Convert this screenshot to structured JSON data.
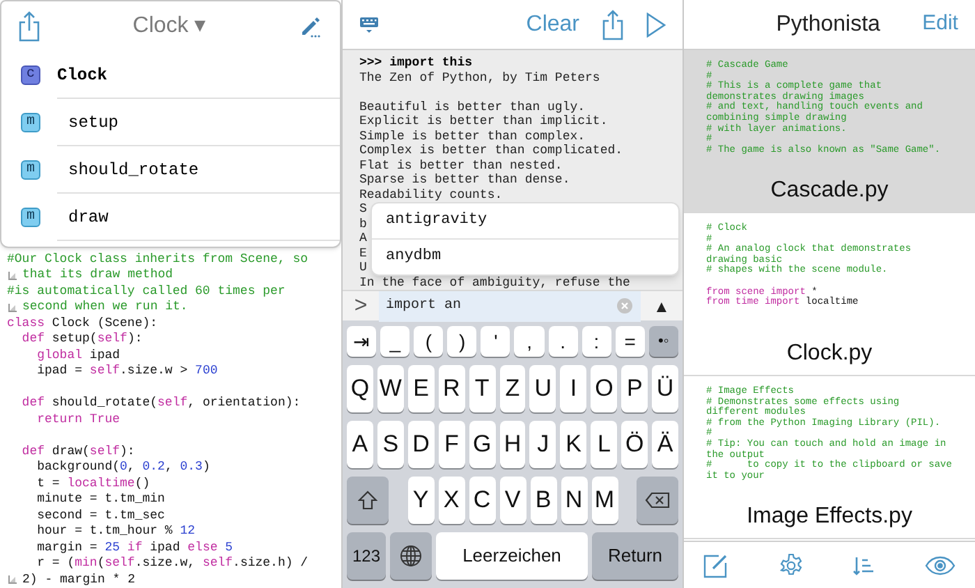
{
  "editor": {
    "title": "Clock ▾",
    "outline": [
      {
        "kind": "class",
        "badge": "c",
        "label": "Clock"
      },
      {
        "kind": "method",
        "badge": "m",
        "label": "setup"
      },
      {
        "kind": "method",
        "badge": "m",
        "label": "should_rotate"
      },
      {
        "kind": "method",
        "badge": "m",
        "label": "draw"
      }
    ],
    "code_lines": [
      {
        "kind": "code",
        "tokens": [
          {
            "kind": "comment",
            "text": "#Our Clock class inherits from Scene, so"
          }
        ]
      },
      {
        "kind": "continuation",
        "tokens": [
          {
            "kind": "comment",
            "text": "that its draw method"
          }
        ]
      },
      {
        "kind": "code",
        "tokens": [
          {
            "kind": "comment",
            "text": "#is automatically called 60 times per"
          }
        ]
      },
      {
        "kind": "continuation",
        "tokens": [
          {
            "kind": "comment",
            "text": "second when we run it."
          }
        ]
      },
      {
        "kind": "code",
        "tokens": [
          {
            "kind": "keyword",
            "text": "class"
          },
          {
            "kind": "plain",
            "text": " Clock (Scene):"
          }
        ]
      },
      {
        "kind": "code",
        "tokens": [
          {
            "kind": "keyword",
            "text": "  def"
          },
          {
            "kind": "plain",
            "text": " setup("
          },
          {
            "kind": "keyword",
            "text": "self"
          },
          {
            "kind": "plain",
            "text": "):"
          }
        ]
      },
      {
        "kind": "code",
        "tokens": [
          {
            "kind": "keyword",
            "text": "    global"
          },
          {
            "kind": "plain",
            "text": " ipad"
          }
        ]
      },
      {
        "kind": "code",
        "tokens": [
          {
            "kind": "plain",
            "text": "    ipad = "
          },
          {
            "kind": "keyword",
            "text": "self"
          },
          {
            "kind": "plain",
            "text": ".size.w > "
          },
          {
            "kind": "number",
            "text": "700"
          }
        ]
      },
      {
        "kind": "blank"
      },
      {
        "kind": "code",
        "tokens": [
          {
            "kind": "keyword",
            "text": "  def"
          },
          {
            "kind": "plain",
            "text": " should_rotate("
          },
          {
            "kind": "keyword",
            "text": "self"
          },
          {
            "kind": "plain",
            "text": ", orientation):"
          }
        ]
      },
      {
        "kind": "code",
        "tokens": [
          {
            "kind": "keyword",
            "text": "    return True"
          }
        ]
      },
      {
        "kind": "blank"
      },
      {
        "kind": "code",
        "tokens": [
          {
            "kind": "keyword",
            "text": "  def"
          },
          {
            "kind": "plain",
            "text": " draw("
          },
          {
            "kind": "keyword",
            "text": "self"
          },
          {
            "kind": "plain",
            "text": "):"
          }
        ]
      },
      {
        "kind": "code",
        "tokens": [
          {
            "kind": "plain",
            "text": "    background("
          },
          {
            "kind": "number",
            "text": "0"
          },
          {
            "kind": "plain",
            "text": ", "
          },
          {
            "kind": "number",
            "text": "0.2"
          },
          {
            "kind": "plain",
            "text": ", "
          },
          {
            "kind": "number",
            "text": "0.3"
          },
          {
            "kind": "plain",
            "text": ")"
          }
        ]
      },
      {
        "kind": "code",
        "tokens": [
          {
            "kind": "plain",
            "text": "    t = "
          },
          {
            "kind": "keyword",
            "text": "localtime"
          },
          {
            "kind": "plain",
            "text": "()"
          }
        ]
      },
      {
        "kind": "code",
        "tokens": [
          {
            "kind": "plain",
            "text": "    minute = t.tm_min"
          }
        ]
      },
      {
        "kind": "code",
        "tokens": [
          {
            "kind": "plain",
            "text": "    second = t.tm_sec"
          }
        ]
      },
      {
        "kind": "code",
        "tokens": [
          {
            "kind": "plain",
            "text": "    hour = t.tm_hour % "
          },
          {
            "kind": "number",
            "text": "12"
          }
        ]
      },
      {
        "kind": "code",
        "tokens": [
          {
            "kind": "plain",
            "text": "    margin = "
          },
          {
            "kind": "number",
            "text": "25"
          },
          {
            "kind": "keyword",
            "text": " if"
          },
          {
            "kind": "plain",
            "text": " ipad "
          },
          {
            "kind": "keyword",
            "text": "else "
          },
          {
            "kind": "number",
            "text": "5"
          }
        ]
      },
      {
        "kind": "code",
        "tokens": [
          {
            "kind": "plain",
            "text": "    r = ("
          },
          {
            "kind": "keyword",
            "text": "min"
          },
          {
            "kind": "plain",
            "text": "("
          },
          {
            "kind": "keyword",
            "text": "self"
          },
          {
            "kind": "plain",
            "text": ".size.w, "
          },
          {
            "kind": "keyword",
            "text": "self"
          },
          {
            "kind": "plain",
            "text": ".size.h) /"
          }
        ]
      },
      {
        "kind": "continuation",
        "tokens": [
          {
            "kind": "plain",
            "text": "2) - margin * 2"
          }
        ]
      }
    ]
  },
  "console": {
    "clear_label": "Clear",
    "lines": [
      {
        "kind": "input",
        "text": ">>> import this"
      },
      {
        "kind": "output",
        "text": "The Zen of Python, by Tim Peters"
      },
      {
        "kind": "blank"
      },
      {
        "kind": "output",
        "text": "Beautiful is better than ugly."
      },
      {
        "kind": "output",
        "text": "Explicit is better than implicit."
      },
      {
        "kind": "output",
        "text": "Simple is better than complex."
      },
      {
        "kind": "output",
        "text": "Complex is better than complicated."
      },
      {
        "kind": "output",
        "text": "Flat is better than nested."
      },
      {
        "kind": "output",
        "text": "Sparse is better than dense."
      },
      {
        "kind": "output",
        "text": "Readability counts."
      },
      {
        "kind": "output",
        "text": "S"
      },
      {
        "kind": "output",
        "text": "b"
      },
      {
        "kind": "output",
        "text": "A"
      },
      {
        "kind": "output",
        "text": "E"
      },
      {
        "kind": "output",
        "text": "U"
      },
      {
        "kind": "output",
        "text": "In the face of ambiguity, refuse the"
      }
    ],
    "completions": [
      "antigravity",
      "anydbm"
    ],
    "prompt": ">",
    "input_value": "import an",
    "history_button": "▲"
  },
  "keyboard": {
    "extra_keys": [
      {
        "kind": "extra",
        "label": "⇥"
      },
      {
        "kind": "extra",
        "label": "_"
      },
      {
        "kind": "extra",
        "label": "("
      },
      {
        "kind": "extra",
        "label": ")"
      },
      {
        "kind": "extra",
        "label": "'"
      },
      {
        "kind": "extra",
        "label": ","
      },
      {
        "kind": "extra",
        "label": "."
      },
      {
        "kind": "extra",
        "label": ":"
      },
      {
        "kind": "extra",
        "label": "="
      },
      {
        "kind": "toggle",
        "label": "•◦"
      }
    ],
    "rows": [
      {
        "keys": [
          {
            "kind": "char",
            "label": "Q"
          },
          {
            "kind": "char",
            "label": "W"
          },
          {
            "kind": "char",
            "label": "E"
          },
          {
            "kind": "char",
            "label": "R"
          },
          {
            "kind": "char",
            "label": "T"
          },
          {
            "kind": "char",
            "label": "Z"
          },
          {
            "kind": "char",
            "label": "U"
          },
          {
            "kind": "char",
            "label": "I"
          },
          {
            "kind": "char",
            "label": "O"
          },
          {
            "kind": "char",
            "label": "P"
          },
          {
            "kind": "char",
            "label": "Ü"
          }
        ]
      },
      {
        "keys": [
          {
            "kind": "char",
            "label": "A"
          },
          {
            "kind": "char",
            "label": "S"
          },
          {
            "kind": "char",
            "label": "D"
          },
          {
            "kind": "char",
            "label": "F"
          },
          {
            "kind": "char",
            "label": "G"
          },
          {
            "kind": "char",
            "label": "H"
          },
          {
            "kind": "char",
            "label": "J"
          },
          {
            "kind": "char",
            "label": "K"
          },
          {
            "kind": "char",
            "label": "L"
          },
          {
            "kind": "char",
            "label": "Ö"
          },
          {
            "kind": "char",
            "label": "Ä"
          }
        ]
      },
      {
        "keys": [
          {
            "kind": "shift"
          },
          {
            "kind": "char",
            "label": "Y"
          },
          {
            "kind": "char",
            "label": "X"
          },
          {
            "kind": "char",
            "label": "C"
          },
          {
            "kind": "char",
            "label": "V"
          },
          {
            "kind": "char",
            "label": "B"
          },
          {
            "kind": "char",
            "label": "N"
          },
          {
            "kind": "char",
            "label": "M"
          },
          {
            "kind": "delete"
          }
        ]
      },
      {
        "keys": [
          {
            "kind": "numbers",
            "label": "123"
          },
          {
            "kind": "globe"
          },
          {
            "kind": "space",
            "label": "Leerzeichen"
          },
          {
            "kind": "return",
            "label": "Return"
          }
        ]
      }
    ]
  },
  "library": {
    "title": "Pythonista",
    "edit_label": "Edit",
    "files": [
      {
        "name": "Cascade.py",
        "selected": true,
        "preview": [
          [
            {
              "kind": "comment",
              "text": "# Cascade Game"
            }
          ],
          [
            {
              "kind": "comment",
              "text": "#"
            }
          ],
          [
            {
              "kind": "comment",
              "text": "# This is a complete game that"
            }
          ],
          [
            {
              "kind": "comment",
              "text": "demonstrates drawing images"
            }
          ],
          [
            {
              "kind": "comment",
              "text": "# and text, handling touch events and"
            }
          ],
          [
            {
              "kind": "comment",
              "text": "combining simple drawing"
            }
          ],
          [
            {
              "kind": "comment",
              "text": "# with layer animations."
            }
          ],
          [
            {
              "kind": "comment",
              "text": "#"
            }
          ],
          [
            {
              "kind": "comment",
              "text": "# The game is also known as \"Same Game\"."
            }
          ]
        ]
      },
      {
        "name": "Clock.py",
        "selected": false,
        "preview": [
          [
            {
              "kind": "comment",
              "text": "# Clock"
            }
          ],
          [
            {
              "kind": "comment",
              "text": "#"
            }
          ],
          [
            {
              "kind": "comment",
              "text": "# An analog clock that demonstrates"
            }
          ],
          [
            {
              "kind": "comment",
              "text": "drawing basic"
            }
          ],
          [
            {
              "kind": "comment",
              "text": "# shapes with the scene module."
            }
          ],
          {
            "kind": "blank"
          },
          [
            {
              "kind": "keyword",
              "text": "from scene import"
            },
            {
              "kind": "plain",
              "text": " *"
            }
          ],
          [
            {
              "kind": "keyword",
              "text": "from time import"
            },
            {
              "kind": "plain",
              "text": " localtime"
            }
          ]
        ]
      },
      {
        "name": "Image Effects.py",
        "selected": false,
        "preview": [
          [
            {
              "kind": "comment",
              "text": "# Image Effects"
            }
          ],
          [
            {
              "kind": "comment",
              "text": "# Demonstrates some effects using"
            }
          ],
          [
            {
              "kind": "comment",
              "text": "different modules"
            }
          ],
          [
            {
              "kind": "comment",
              "text": "# from the Python Imaging Library (PIL)."
            }
          ],
          [
            {
              "kind": "comment",
              "text": "#"
            }
          ],
          [
            {
              "kind": "comment",
              "text": "# Tip: You can touch and hold an image in"
            }
          ],
          [
            {
              "kind": "comment",
              "text": "the output"
            }
          ],
          [
            {
              "kind": "comment",
              "text": "#      to copy it to the clipboard or save"
            }
          ],
          [
            {
              "kind": "comment",
              "text": "it to your"
            }
          ]
        ]
      }
    ]
  }
}
